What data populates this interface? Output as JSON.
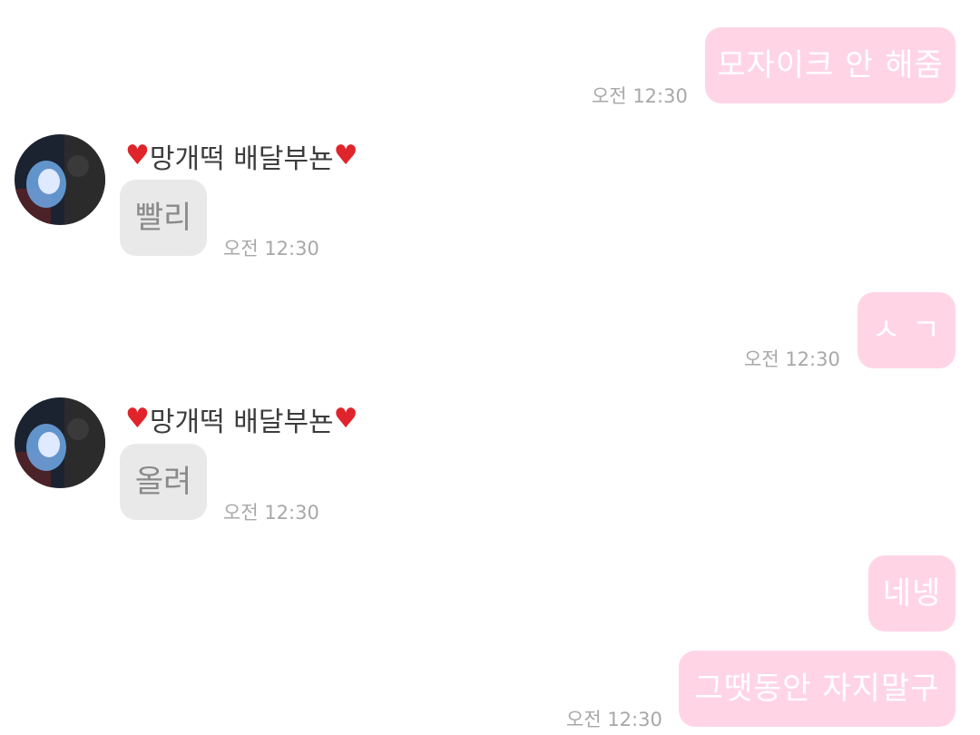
{
  "colors": {
    "outgoing_bubble": "#ffd5e6",
    "incoming_bubble": "#e9e9e9",
    "timestamp": "#a8a8a8",
    "heart": "#e0242c"
  },
  "messages": [
    {
      "direction": "out",
      "text": "모자이크 안 해줌",
      "time": "오전 12:30"
    },
    {
      "direction": "in",
      "sender": "망개떡 배달부뇬",
      "text": "빨리",
      "time": "오전 12:30"
    },
    {
      "direction": "out",
      "text": "ㅅ ㄱ",
      "time": "오전 12:30"
    },
    {
      "direction": "in",
      "sender": "망개떡 배달부뇬",
      "text": "올려",
      "time": "오전 12:30"
    },
    {
      "direction": "out",
      "text": "네넹"
    },
    {
      "direction": "out",
      "text": "그땟동안 자지말구",
      "time": "오전 12:30"
    }
  ]
}
